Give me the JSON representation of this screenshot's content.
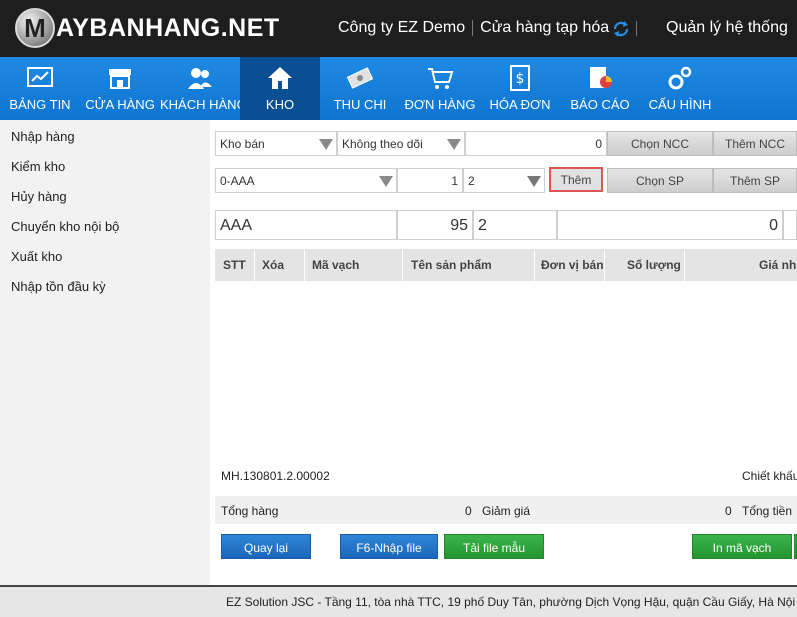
{
  "header": {
    "logo_letter": "M",
    "logo_text": "AYBANHANG.NET",
    "company": "Công ty EZ Demo",
    "store": "Cửa hàng tạp hóa",
    "admin": "Quản lý hệ thống"
  },
  "nav": [
    {
      "label": "BẢNG TIN",
      "icon": "dashboard-icon"
    },
    {
      "label": "CỬA HÀNG",
      "icon": "store-icon"
    },
    {
      "label": "KHÁCH HÀNG",
      "icon": "customers-icon"
    },
    {
      "label": "KHO",
      "icon": "warehouse-icon"
    },
    {
      "label": "THU CHI",
      "icon": "money-icon"
    },
    {
      "label": "ĐƠN HÀNG",
      "icon": "cart-icon"
    },
    {
      "label": "HÓA ĐƠN",
      "icon": "invoice-icon"
    },
    {
      "label": "BÁO CÁO",
      "icon": "report-icon"
    },
    {
      "label": "CẤU HÌNH",
      "icon": "settings-icon"
    }
  ],
  "sidebar": [
    "Nhập hàng",
    "Kiểm kho",
    "Hủy hàng",
    "Chuyển kho nội bộ",
    "Xuất kho",
    "Nhập tồn đầu kỳ"
  ],
  "form": {
    "warehouse": "Kho bán",
    "tracking": "Không theo dõi",
    "supplier_value": "0",
    "choose_supplier": "Chọn NCC",
    "add_supplier": "Thêm NCC",
    "product_select": "0-AAA",
    "qty": "1",
    "unit": "2",
    "add": "Thêm",
    "choose_product": "Chọn SP",
    "add_product": "Thêm SP",
    "product_name": "AAA",
    "product_qty": "95",
    "product_unit": "2",
    "product_value": "0"
  },
  "table": {
    "columns": [
      "STT",
      "Xóa",
      "Mã vạch",
      "Tên sản phẩm",
      "Đơn vị bán",
      "Số lượng",
      "Giá nh"
    ]
  },
  "summary": {
    "code": "MH.130801.2.00002",
    "discount_label": "Chiết khấu",
    "total_goods_label": "Tổng hàng",
    "total_goods_value": "0",
    "reduction_label": "Giảm giá",
    "reduction_value": "0",
    "total_money_label": "Tổng tiền"
  },
  "buttons": {
    "back": "Quay lại",
    "import_file": "F6-Nhập file",
    "download_template": "Tải file mẫu",
    "print_barcode": "In mã vạch"
  },
  "footer": "EZ Solution JSC - Tầng 11, tòa nhà TTC, 19 phố Duy Tân, phường Dịch Vọng Hậu, quận Cầu Giấy, Hà Nội"
}
